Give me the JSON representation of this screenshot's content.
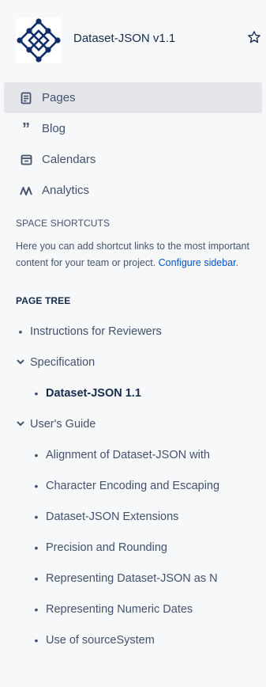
{
  "space": {
    "title": "Dataset-JSON v1.1",
    "logo_icon": "network-diamond-logo",
    "star_icon": "star-icon"
  },
  "nav": {
    "items": [
      {
        "label": "Pages",
        "icon": "pages-icon",
        "active": true
      },
      {
        "label": "Blog",
        "icon": "quote-icon"
      },
      {
        "label": "Calendars",
        "icon": "calendar-icon"
      },
      {
        "label": "Analytics",
        "icon": "analytics-icon"
      }
    ]
  },
  "shortcuts": {
    "heading": "SPACE SHORTCUTS",
    "text": "Here you can add shortcut links to the most important content for your team or project.",
    "link": "Configure sidebar",
    "after_link": "."
  },
  "tree": {
    "heading": "PAGE TREE",
    "rows": [
      {
        "label": "Instructions for Reviewers",
        "level": 0,
        "type": "bullet"
      },
      {
        "label": "Specification",
        "level": 0,
        "type": "chevron"
      },
      {
        "label": "Dataset-JSON 1.1",
        "level": 1,
        "type": "bullet",
        "current": true
      },
      {
        "label": "User's Guide",
        "level": 0,
        "type": "chevron"
      },
      {
        "label": "Alignment of Dataset-JSON with",
        "level": 1,
        "type": "bullet"
      },
      {
        "label": "Character Encoding and Escaping",
        "level": 1,
        "type": "bullet"
      },
      {
        "label": "Dataset-JSON Extensions",
        "level": 1,
        "type": "bullet"
      },
      {
        "label": "Precision and Rounding",
        "level": 1,
        "type": "bullet"
      },
      {
        "label": "Representing Dataset-JSON as N",
        "level": 1,
        "type": "bullet"
      },
      {
        "label": "Representing Numeric Dates",
        "level": 1,
        "type": "bullet"
      },
      {
        "label": "Use of sourceSystem",
        "level": 1,
        "type": "bullet"
      }
    ]
  },
  "colors": {
    "logo_navy": "#0f2d6a",
    "link": "#0052cc",
    "active_bg": "#e4e6ea"
  }
}
